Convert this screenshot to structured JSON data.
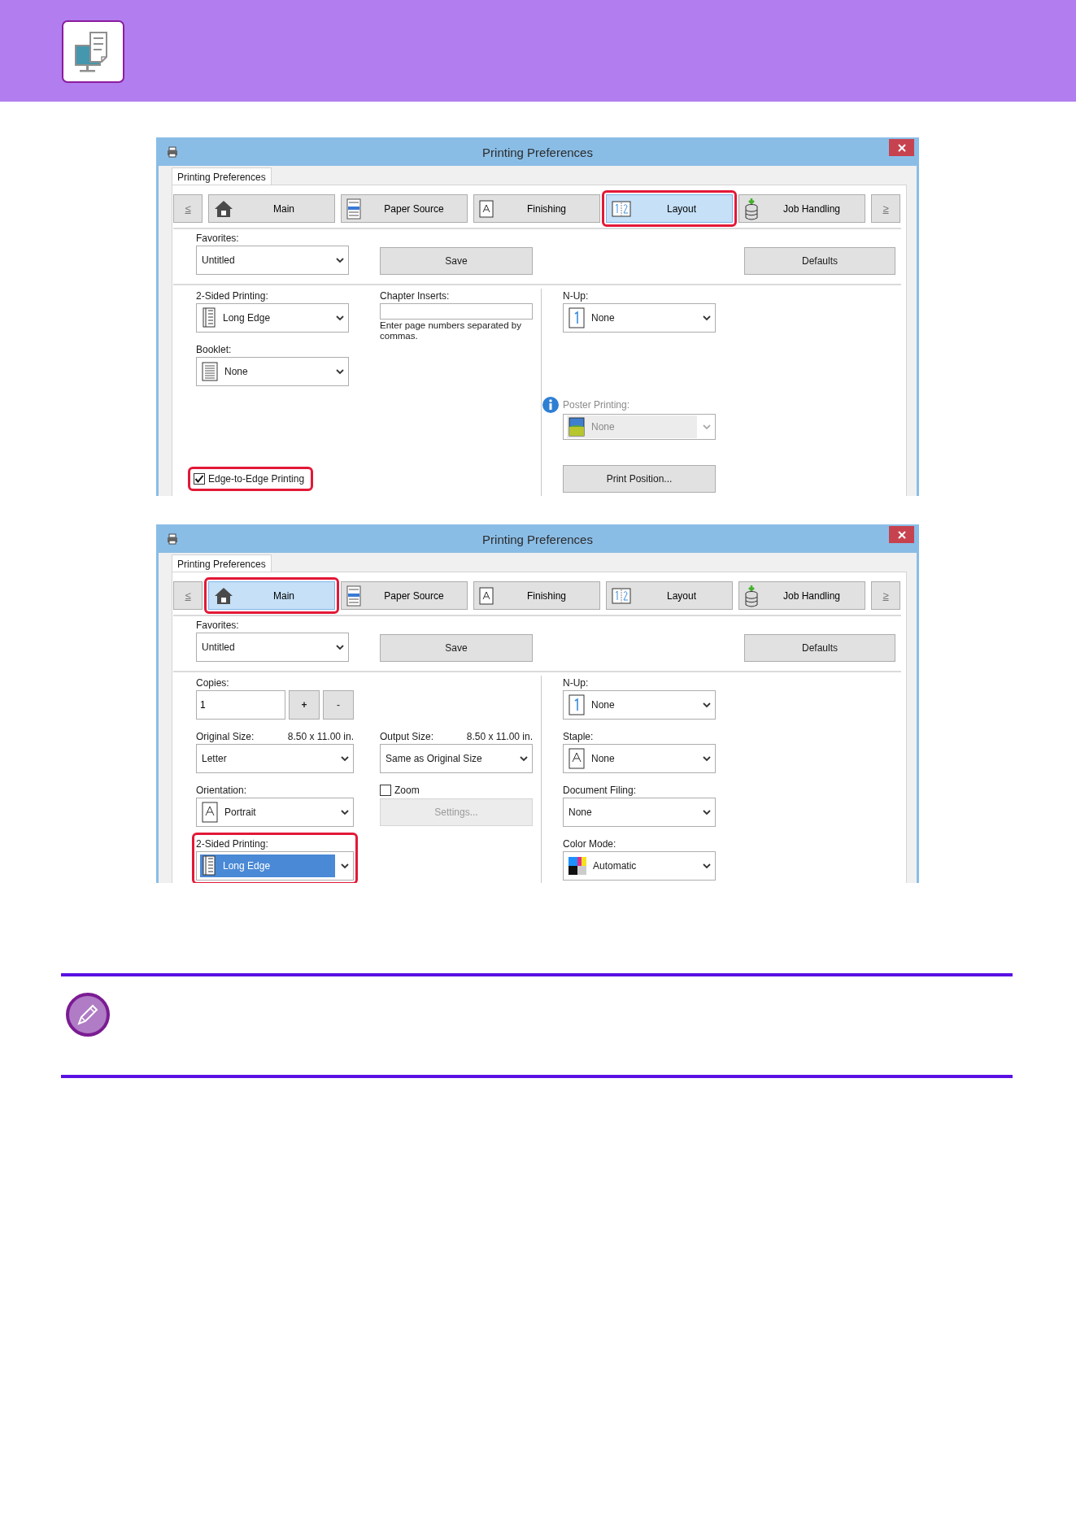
{
  "dialogs": [
    {
      "title": "Printing Preferences",
      "page_tab": "Printing Preferences",
      "prev": "≤",
      "next": "≥",
      "tabs": [
        {
          "label": "Main",
          "selected": false,
          "highlighted": false
        },
        {
          "label": "Paper Source",
          "selected": false,
          "highlighted": false
        },
        {
          "label": "Finishing",
          "selected": false,
          "highlighted": false
        },
        {
          "label": "Layout",
          "selected": true,
          "highlighted": true
        },
        {
          "label": "Job Handling",
          "selected": false,
          "highlighted": false
        }
      ],
      "favorites": {
        "label": "Favorites:",
        "value": "Untitled"
      },
      "save": "Save",
      "defaults": "Defaults",
      "columns": [
        [
          {
            "kind": "select",
            "label": "2-Sided Printing:",
            "value": "Long Edge",
            "disabled": false,
            "focused": false,
            "highlighted": false,
            "info": false
          },
          {
            "kind": "select",
            "label": "Booklet:",
            "value": "None",
            "disabled": false,
            "focused": false,
            "highlighted": false,
            "info": false
          },
          {
            "kind": "checkbox",
            "label": "Edge-to-Edge Printing",
            "checked": true,
            "highlighted": true
          }
        ],
        [
          {
            "kind": "text-input",
            "label": "Chapter Inserts:",
            "hint": "Enter page numbers separated by commas."
          }
        ],
        [
          {
            "kind": "select",
            "label": "N-Up:",
            "value": "None",
            "disabled": false,
            "focused": false,
            "highlighted": false,
            "info": false
          },
          {
            "kind": "select",
            "label": "Poster Printing:",
            "value": "None",
            "disabled": true,
            "focused": false,
            "highlighted": false,
            "info": true
          },
          {
            "kind": "button",
            "label": "Print Position...",
            "disabled": false
          }
        ]
      ]
    },
    {
      "title": "Printing Preferences",
      "page_tab": "Printing Preferences",
      "prev": "≤",
      "next": "≥",
      "tabs": [
        {
          "label": "Main",
          "selected": true,
          "highlighted": true
        },
        {
          "label": "Paper Source",
          "selected": false,
          "highlighted": false
        },
        {
          "label": "Finishing",
          "selected": false,
          "highlighted": false
        },
        {
          "label": "Layout",
          "selected": false,
          "highlighted": false
        },
        {
          "label": "Job Handling",
          "selected": false,
          "highlighted": false
        }
      ],
      "favorites": {
        "label": "Favorites:",
        "value": "Untitled"
      },
      "save": "Save",
      "defaults": "Defaults",
      "columns": [
        [
          {
            "kind": "spinner",
            "label": "Copies:",
            "value": "1",
            "plus": "+",
            "minus": "-"
          },
          {
            "kind": "select",
            "label": "Original Size:",
            "aside": "8.50 x 11.00 in.",
            "value": "Letter",
            "disabled": false,
            "focused": false,
            "highlighted": false,
            "info": false
          },
          {
            "kind": "select",
            "label": "Orientation:",
            "value": "Portrait",
            "disabled": false,
            "focused": false,
            "highlighted": false,
            "info": false
          },
          {
            "kind": "select",
            "label": "2-Sided Printing:",
            "value": "Long Edge",
            "disabled": false,
            "focused": true,
            "highlighted": true,
            "info": false
          }
        ],
        [
          {
            "kind": "select",
            "label": "Output Size:",
            "aside": "8.50 x 11.00 in.",
            "value": "Same as Original Size",
            "disabled": false,
            "focused": false,
            "highlighted": false,
            "info": false
          },
          {
            "kind": "checkbox",
            "label": "Zoom",
            "checked": false,
            "highlighted": false
          },
          {
            "kind": "button",
            "label": "Settings...",
            "disabled": true
          }
        ],
        [
          {
            "kind": "select",
            "label": "N-Up:",
            "value": "None",
            "disabled": false,
            "focused": false,
            "highlighted": false,
            "info": false
          },
          {
            "kind": "select",
            "label": "Staple:",
            "value": "None",
            "disabled": false,
            "focused": false,
            "highlighted": false,
            "info": false
          },
          {
            "kind": "select",
            "label": "Document Filing:",
            "value": "None",
            "disabled": false,
            "focused": false,
            "highlighted": false,
            "info": false
          },
          {
            "kind": "select",
            "label": "Color Mode:",
            "value": "Automatic",
            "disabled": false,
            "focused": false,
            "highlighted": false,
            "info": false
          }
        ]
      ]
    }
  ]
}
